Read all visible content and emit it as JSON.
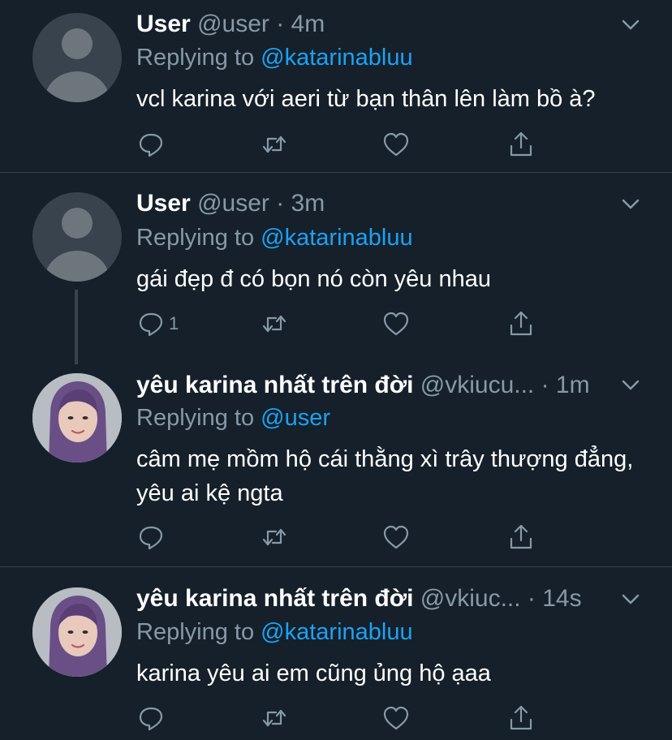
{
  "tweets": [
    {
      "name": "User",
      "handle": "@user",
      "time": "· 4m",
      "replying_prefix": "Replying to",
      "replying_to": "@katarinabluu",
      "text": "vcl karina với aeri từ bạn thân lên làm bồ à?",
      "reply_count": "",
      "avatar": "default-avatar"
    },
    {
      "name": "User",
      "handle": "@user",
      "time": "· 3m",
      "replying_prefix": "Replying to",
      "replying_to": "@katarinabluu",
      "text": "gái đẹp đ có bọn nó còn yêu nhau",
      "reply_count": "1",
      "avatar": "default-avatar"
    },
    {
      "name": "yêu karina nhất trên đời",
      "handle": "@vkiucu...",
      "time": "· 1m",
      "replying_prefix": "Replying to",
      "replying_to": "@user",
      "text": "câm mẹ mồm hộ cái thằng xì trây thượng đẳng, yêu ai kệ ngta",
      "reply_count": "",
      "avatar": "photo-avatar"
    },
    {
      "name": "yêu karina nhất trên đời",
      "handle": "@vkiuc...",
      "time": "· 14s",
      "replying_prefix": "Replying to",
      "replying_to": "@katarinabluu",
      "text": "karina yêu ai em cũng ủng hộ ạaa",
      "reply_count": "",
      "avatar": "photo-avatar"
    }
  ],
  "icons": {
    "reply": "reply-icon",
    "retweet": "retweet-icon",
    "like": "heart-icon",
    "share": "share-icon",
    "more": "chevron-down-icon"
  },
  "colors": {
    "background": "#15202b",
    "divider": "#38444d",
    "secondary_text": "#8899a6",
    "link": "#1da1f2",
    "primary_text": "#ffffff"
  }
}
